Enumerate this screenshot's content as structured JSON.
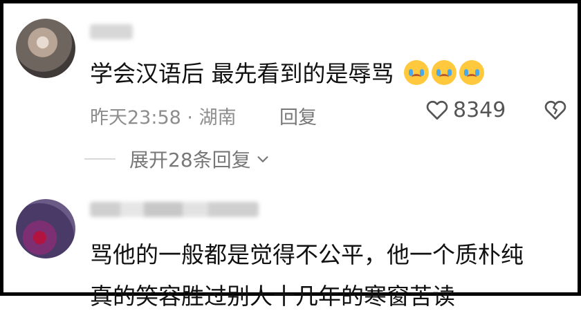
{
  "comments": [
    {
      "text": "学会汉语后 最先看到的是辱骂",
      "emojis": [
        "crying-face",
        "crying-face",
        "crying-face"
      ],
      "time": "昨天23:58",
      "separator": "·",
      "location": "湖南",
      "reply_label": "回复",
      "like_count": "8349",
      "expand_replies_label": "展开28条回复"
    },
    {
      "text_line1": "骂他的一般都是觉得不公平，他一个质朴纯",
      "text_line2": "真的笑容胜过别人十几年的寒窗苦读"
    }
  ],
  "icons": {
    "like": "heart-outline-icon",
    "dislike": "broken-heart-icon",
    "expand": "chevron-down-icon",
    "emoji": "crying-face-emoji"
  },
  "colors": {
    "text": "#111111",
    "meta": "#8d8d8d",
    "divider": "#d8d8d8",
    "icon": "#555555"
  }
}
